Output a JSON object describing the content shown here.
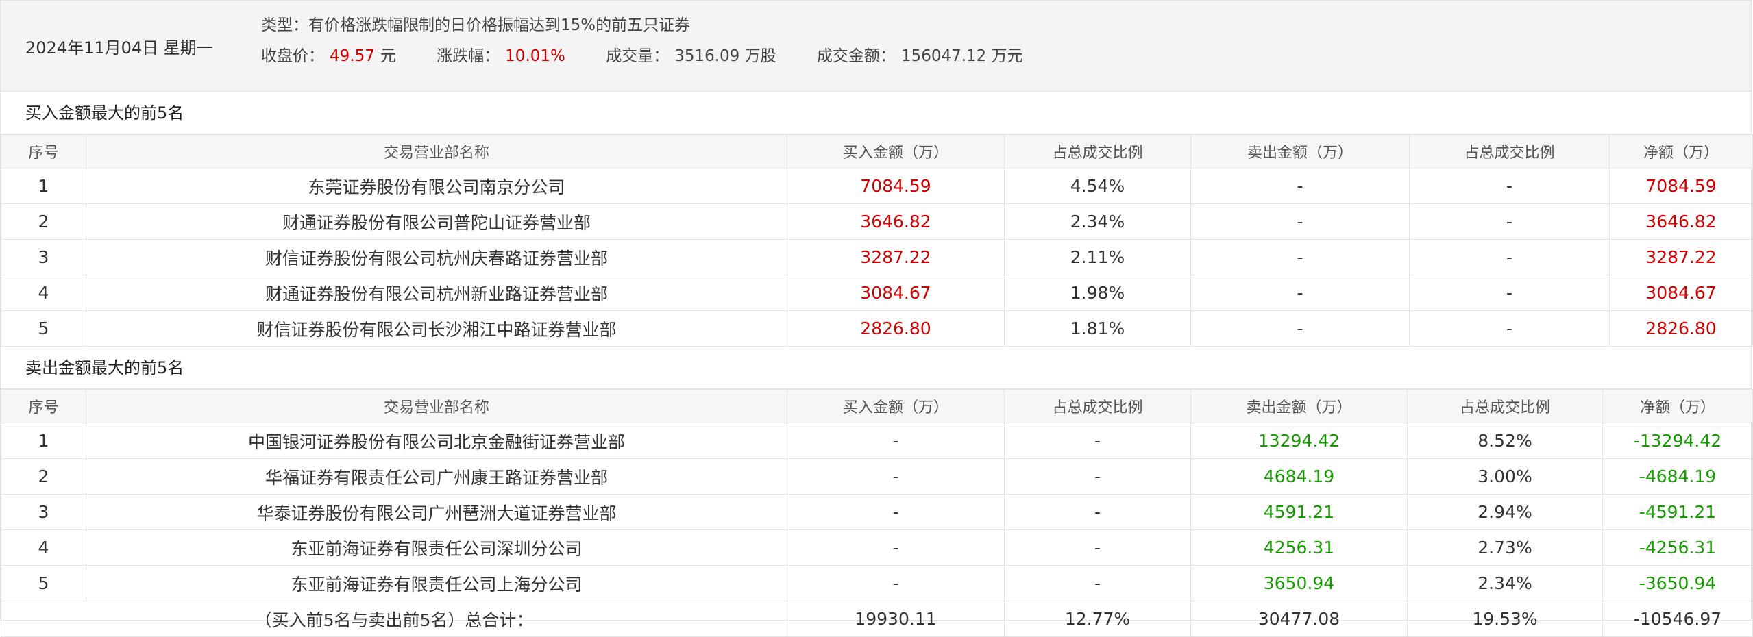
{
  "header": {
    "date": "2024年11月04日 星期一",
    "type_label": "类型：",
    "type_value": "有价格涨跌幅限制的日价格振幅达到15%的前五只证券",
    "close_label": "收盘价：",
    "close_value": "49.57",
    "close_unit": "元",
    "change_label": "涨跌幅：",
    "change_value": "10.01%",
    "volume_label": "成交量：",
    "volume_value": "3516.09 万股",
    "amount_label": "成交金额：",
    "amount_value": "156047.12 万元"
  },
  "colors": {
    "buy": "#d10000",
    "sell": "#159a00",
    "header_bg": "#f4f4f4",
    "border": "#e3e3e3"
  },
  "columns": [
    "序号",
    "交易营业部名称",
    "买入金额（万）",
    "占总成交比例",
    "卖出金额（万）",
    "占总成交比例",
    "净额（万）"
  ],
  "buy_section": {
    "title": "买入金额最大的前5名",
    "rows": [
      {
        "no": "1",
        "name": "东莞证券股份有限公司南京分公司",
        "buy": "7084.59",
        "buy_ratio": "4.54%",
        "sell": "-",
        "sell_ratio": "-",
        "net": "7084.59"
      },
      {
        "no": "2",
        "name": "财通证券股份有限公司普陀山证券营业部",
        "buy": "3646.82",
        "buy_ratio": "2.34%",
        "sell": "-",
        "sell_ratio": "-",
        "net": "3646.82"
      },
      {
        "no": "3",
        "name": "财信证券股份有限公司杭州庆春路证券营业部",
        "buy": "3287.22",
        "buy_ratio": "2.11%",
        "sell": "-",
        "sell_ratio": "-",
        "net": "3287.22"
      },
      {
        "no": "4",
        "name": "财通证券股份有限公司杭州新业路证券营业部",
        "buy": "3084.67",
        "buy_ratio": "1.98%",
        "sell": "-",
        "sell_ratio": "-",
        "net": "3084.67"
      },
      {
        "no": "5",
        "name": "财信证券股份有限公司长沙湘江中路证券营业部",
        "buy": "2826.80",
        "buy_ratio": "1.81%",
        "sell": "-",
        "sell_ratio": "-",
        "net": "2826.80"
      }
    ]
  },
  "sell_section": {
    "title": "卖出金额最大的前5名",
    "rows": [
      {
        "no": "1",
        "name": "中国银河证券股份有限公司北京金融街证券营业部",
        "buy": "-",
        "buy_ratio": "-",
        "sell": "13294.42",
        "sell_ratio": "8.52%",
        "net": "-13294.42"
      },
      {
        "no": "2",
        "name": "华福证券有限责任公司广州康王路证券营业部",
        "buy": "-",
        "buy_ratio": "-",
        "sell": "4684.19",
        "sell_ratio": "3.00%",
        "net": "-4684.19"
      },
      {
        "no": "3",
        "name": "华泰证券股份有限公司广州琶洲大道证券营业部",
        "buy": "-",
        "buy_ratio": "-",
        "sell": "4591.21",
        "sell_ratio": "2.94%",
        "net": "-4591.21"
      },
      {
        "no": "4",
        "name": "东亚前海证券有限责任公司深圳分公司",
        "buy": "-",
        "buy_ratio": "-",
        "sell": "4256.31",
        "sell_ratio": "2.73%",
        "net": "-4256.31"
      },
      {
        "no": "5",
        "name": "东亚前海证券有限责任公司上海分公司",
        "buy": "-",
        "buy_ratio": "-",
        "sell": "3650.94",
        "sell_ratio": "2.34%",
        "net": "-3650.94"
      }
    ],
    "total": {
      "label": "（买入前5名与卖出前5名）总合计：",
      "buy": "19930.11",
      "buy_ratio": "12.77%",
      "sell": "30477.08",
      "sell_ratio": "19.53%",
      "net": "-10546.97"
    }
  }
}
